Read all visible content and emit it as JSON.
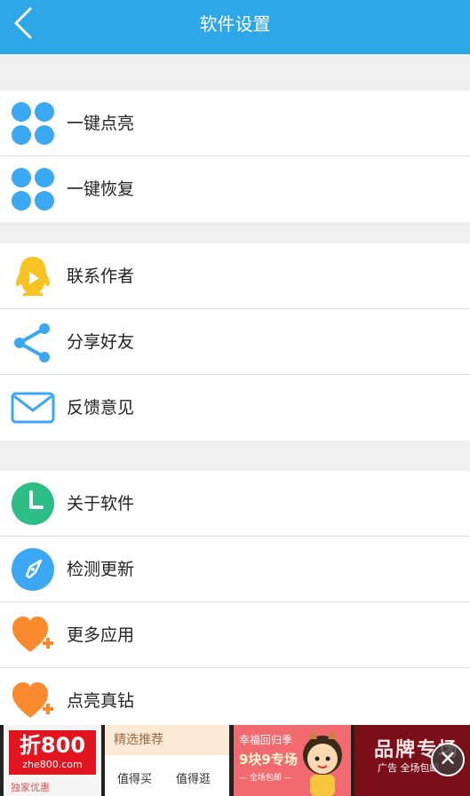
{
  "header": {
    "title": "软件设置",
    "back_icon": "chevron-left-icon"
  },
  "section1": {
    "items": [
      {
        "label": "一键点亮",
        "icon": "grid-dots-icon"
      },
      {
        "label": "一键恢复",
        "icon": "grid-dots-icon"
      }
    ]
  },
  "section2": {
    "items": [
      {
        "label": "联系作者",
        "icon": "qq-penguin-icon"
      },
      {
        "label": "分享好友",
        "icon": "share-icon"
      },
      {
        "label": "反馈意见",
        "icon": "mail-icon"
      }
    ]
  },
  "section3": {
    "items": [
      {
        "label": "关于软件",
        "icon": "clock-icon"
      },
      {
        "label": "检测更新",
        "icon": "compass-icon"
      },
      {
        "label": "更多应用",
        "icon": "heart-plus-icon"
      },
      {
        "label": "点亮真钻",
        "icon": "heart-plus-icon"
      }
    ]
  },
  "colors": {
    "header_bg": "#2ea7e8",
    "blue_icon": "#3aa8f2",
    "yellow_icon": "#f8c325",
    "green_icon": "#2cbe86",
    "orange_icon": "#fb8a2e"
  },
  "ads": {
    "ad1": {
      "brand": "折800",
      "domain": "zhe800.com",
      "sub": "独家优惠"
    },
    "ad2": {
      "head": "精选推荐",
      "link1": "值得买",
      "link2": "值得逛"
    },
    "ad3": {
      "line1": "幸福回归季",
      "line2": "9块9专场",
      "line3": "— 全场包邮 —"
    },
    "ad4": {
      "line1": "品牌专场",
      "line2": "广告 全场包邮"
    },
    "close_icon": "close-icon"
  }
}
